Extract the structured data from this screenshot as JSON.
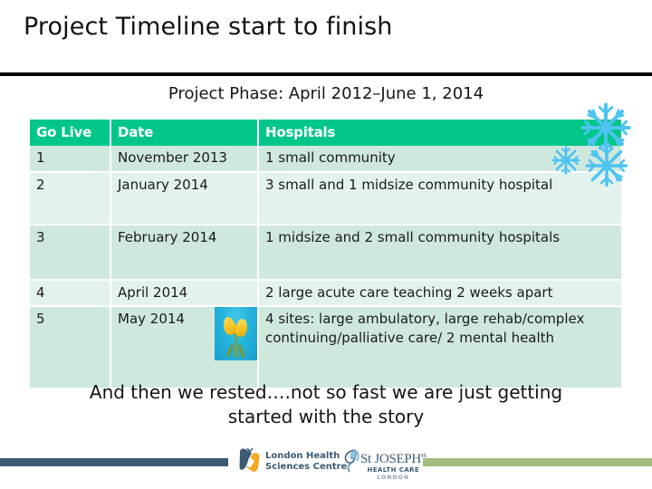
{
  "slide": {
    "title": "Project Timeline start to finish",
    "subtitle": "Project Phase: April 2012–June 1, 2014",
    "closing_text": "And then we rested….not so fast we are just getting started with the story"
  },
  "table": {
    "headers": {
      "go_live": "Go Live",
      "date": "Date",
      "hospitals": "Hospitals"
    },
    "rows": [
      {
        "go_live": "1",
        "date": "November 2013",
        "hospitals": "1 small community"
      },
      {
        "go_live": "2",
        "date": "January 2014",
        "hospitals": "3 small and 1 midsize community hospital"
      },
      {
        "go_live": "3",
        "date": "February 2014",
        "hospitals": "1 midsize and 2 small community hospitals"
      },
      {
        "go_live": "4",
        "date": "April 2014",
        "hospitals": "2 large acute care teaching 2 weeks apart"
      },
      {
        "go_live": "5",
        "date": "May 2014",
        "hospitals": "4 sites: large ambulatory, large rehab/complex continuing/palliative care/ 2 mental health"
      }
    ]
  },
  "decorations": {
    "snowflake_label": "snowflake",
    "tulip_label": "yellow tulips photo"
  },
  "footer": {
    "lhsc_line1": "London Health",
    "lhsc_line2": "Sciences Centre",
    "stjoe_line1": "St JOSEPH'",
    "stjoe_sup": "s",
    "stjoe_line2": "HEALTH CARE",
    "stjoe_line3": "LONDON"
  },
  "colors": {
    "header_green": "#00c68a",
    "row_shade_a": "#cfe8de",
    "row_shade_b": "#e3f2ec",
    "snowflake_blue": "#4fc3f0",
    "footer_left_bar": "#3d5a73",
    "footer_right_bar": "#a3bd7e"
  }
}
